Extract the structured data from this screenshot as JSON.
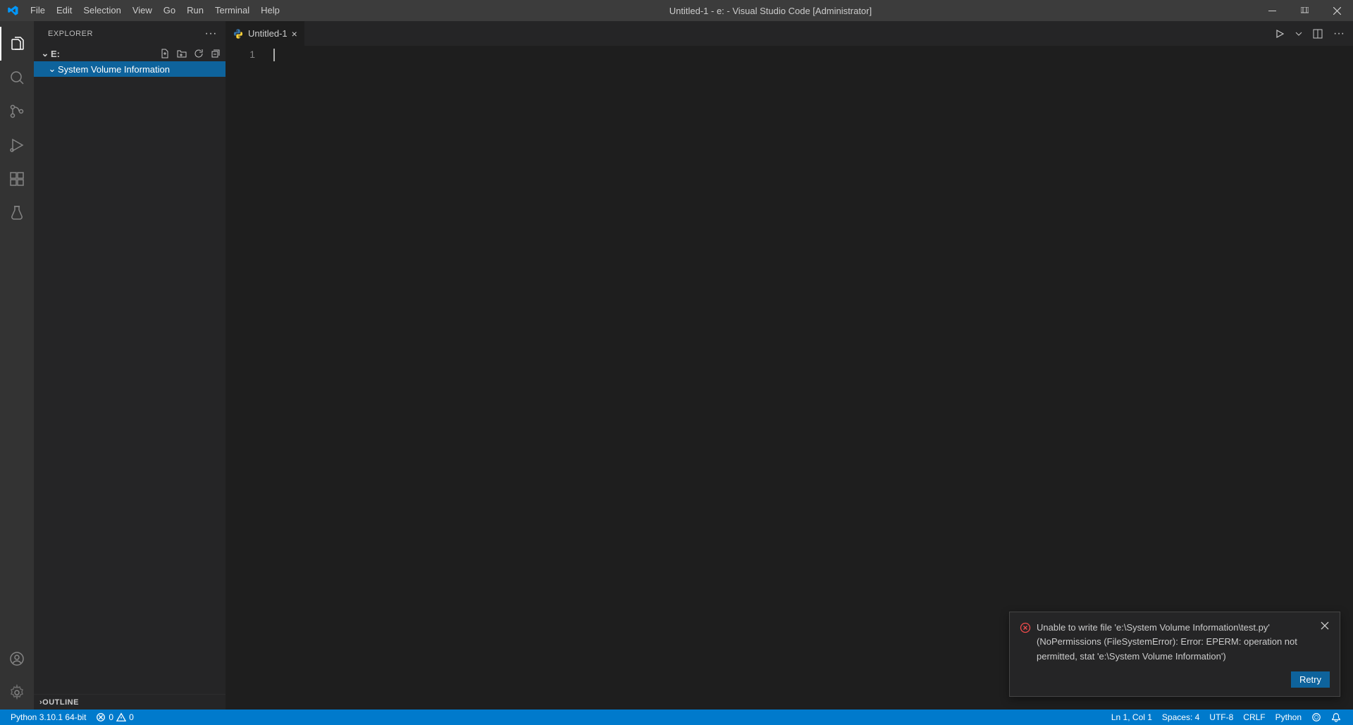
{
  "titleBar": {
    "menu": [
      "File",
      "Edit",
      "Selection",
      "View",
      "Go",
      "Run",
      "Terminal",
      "Help"
    ],
    "title": "Untitled-1 - e: - Visual Studio Code [Administrator]"
  },
  "sidebar": {
    "header": "EXPLORER",
    "rootFolder": "E:",
    "selectedFolder": "System Volume Information",
    "outline": "OUTLINE"
  },
  "editor": {
    "tab": {
      "name": "Untitled-1"
    },
    "lineNumber": "1"
  },
  "notification": {
    "message": "Unable to write file 'e:\\System Volume Information\\test.py' (NoPermissions (FileSystemError): Error: EPERM: operation not permitted, stat 'e:\\System Volume Information')",
    "retry": "Retry"
  },
  "statusBar": {
    "python": "Python 3.10.1 64-bit",
    "errors": "0",
    "warnings": "0",
    "position": "Ln 1, Col 1",
    "spaces": "Spaces: 4",
    "encoding": "UTF-8",
    "eol": "CRLF",
    "language": "Python"
  }
}
